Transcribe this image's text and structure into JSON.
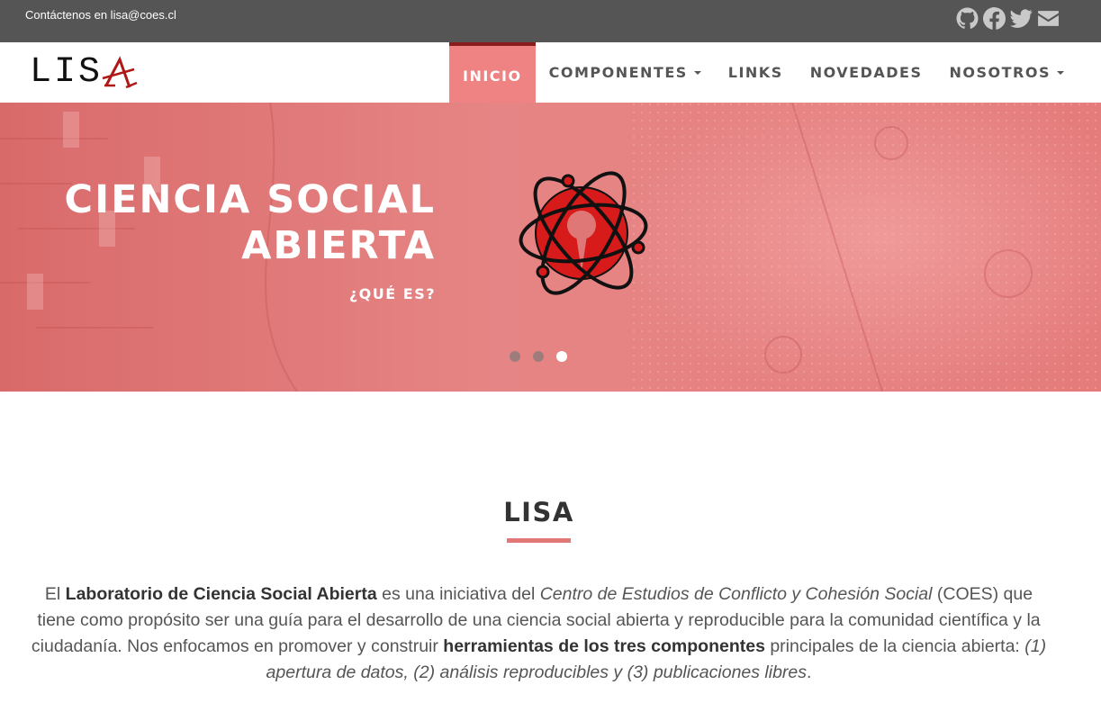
{
  "topbar": {
    "contact": "Contáctenos en lisa@coes.cl",
    "social_icons": [
      "github-icon",
      "facebook-icon",
      "twitter-icon",
      "envelope-icon"
    ]
  },
  "logo": {
    "text": "LIS",
    "accent_letter": "A"
  },
  "nav": {
    "items": [
      {
        "label": "INICIO",
        "active": true,
        "dropdown": false
      },
      {
        "label": "COMPONENTES",
        "active": false,
        "dropdown": true
      },
      {
        "label": "LINKS",
        "active": false,
        "dropdown": false
      },
      {
        "label": "NOVEDADES",
        "active": false,
        "dropdown": false
      },
      {
        "label": "NOSOTROS",
        "active": false,
        "dropdown": true
      }
    ]
  },
  "hero": {
    "title_line1": "CIENCIA SOCIAL",
    "title_line2": "ABIERTA",
    "cta": "¿QUÉ ES?",
    "slides_count": 3,
    "active_slide": 3
  },
  "section": {
    "title": "LISA",
    "intro": {
      "p1": "El ",
      "b1": "Laboratorio de Ciencia Social Abierta",
      "p2": " es una iniciativa del ",
      "i1": "Centro de Estudios de Conflicto y Cohesión Social",
      "p3": " (COES) que tiene como propósito ser una guía para el desarrollo de una ciencia social abierta y reproducible para la comunidad científica y la ciudadanía. Nos enfocamos en promover y construir ",
      "b2": "herramientas de los tres componentes",
      "p4": " principales de la ciencia abierta: ",
      "i2": "(1) apertura de datos, (2) análisis reproducibles y (3) publicaciones libres",
      "p5": "."
    }
  },
  "colors": {
    "topbar": "#555555",
    "accent": "#ef8383",
    "accent_dark": "#8b1c1c",
    "hero": "#e07777"
  }
}
